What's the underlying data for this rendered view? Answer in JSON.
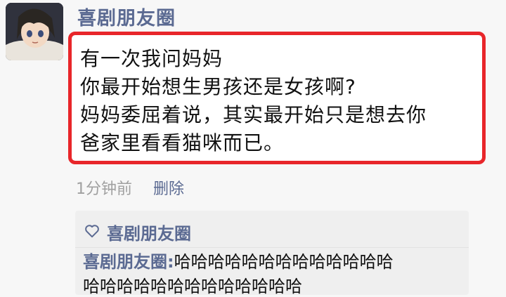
{
  "post": {
    "author": "喜剧朋友圈",
    "lines": [
      "有一次我问妈妈",
      "你最开始想生男孩还是女孩啊?",
      "妈妈委屈着说，其实最开始只是想去你",
      "爸家里看看猫咪而已。"
    ],
    "time": "1分钟前",
    "delete_label": "删除"
  },
  "likes": {
    "icon": "heart-outline-icon",
    "names": "喜剧朋友圈"
  },
  "comment": {
    "author": "喜剧朋友圈:",
    "text": "哈哈哈哈哈哈哈哈哈哈哈哈哈",
    "text_line2": "哈哈哈哈哈哈哈哈哈哈哈哈哈"
  },
  "colors": {
    "name_blue": "#5b6a92",
    "highlight_red": "#e8262a"
  }
}
